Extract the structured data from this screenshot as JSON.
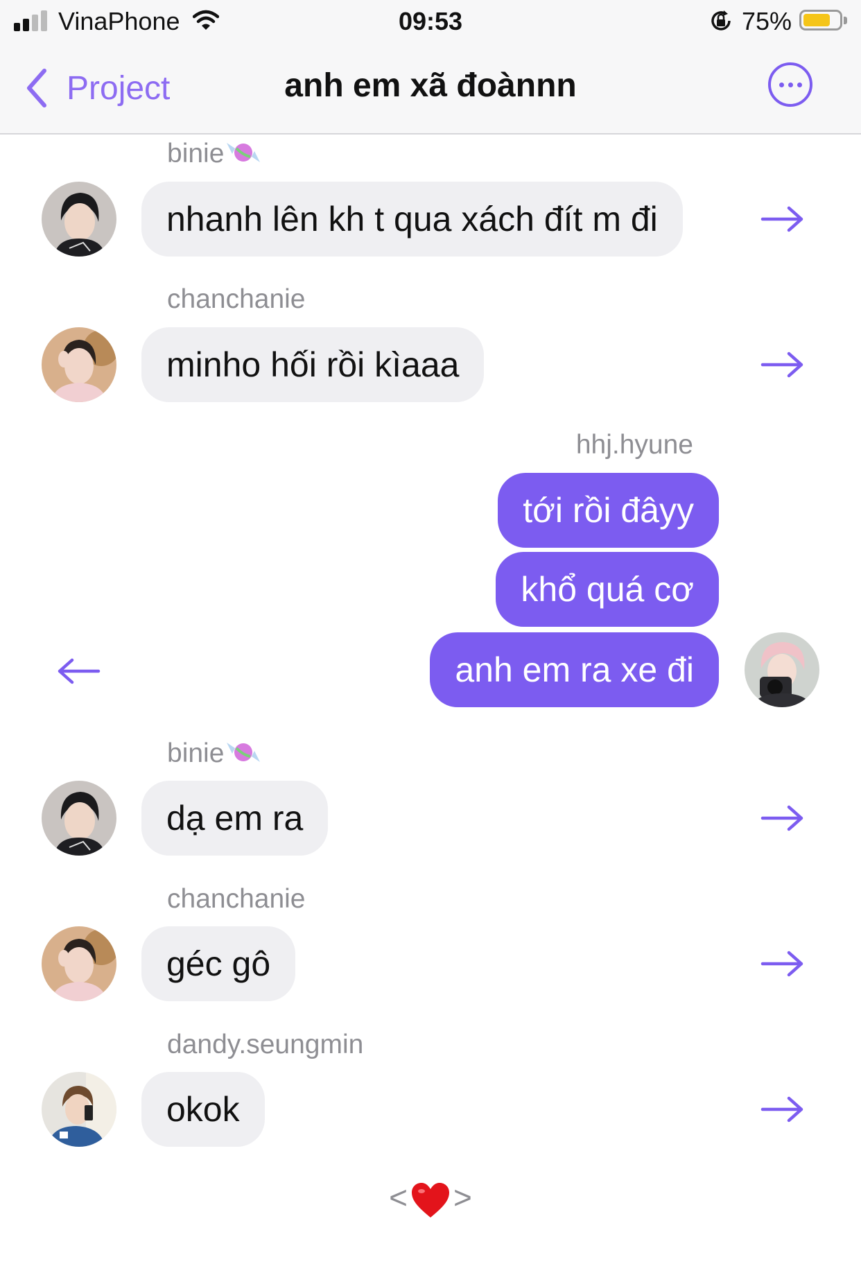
{
  "status_bar": {
    "carrier": "VinaPhone",
    "time": "09:53",
    "battery_percent": "75%",
    "battery_level": 0.75,
    "battery_color": "#f5c518",
    "icons": [
      "signal-icon",
      "wifi-icon",
      "orientation-lock-icon",
      "battery-icon"
    ]
  },
  "nav": {
    "back_label": "Project",
    "title": "anh em xã đoànnn",
    "more_icon": "ellipsis-circle-icon",
    "accent": "#7c5cf0"
  },
  "messages": [
    {
      "sender": "binie",
      "sender_emoji": "candy",
      "text": "nhanh lên kh t qua xách đít m đi",
      "direction": "incoming"
    },
    {
      "sender": "chanchanie",
      "text": "minho hối rồi kìaaa",
      "direction": "incoming"
    },
    {
      "sender": "hhj.hyune",
      "direction": "outgoing",
      "texts": [
        "tới rồi đâyy",
        "khổ quá cơ",
        "anh em ra xe đi"
      ]
    },
    {
      "sender": "binie",
      "sender_emoji": "candy",
      "text": "dạ em ra",
      "direction": "incoming"
    },
    {
      "sender": "chanchanie",
      "text": "géc gô",
      "direction": "incoming"
    },
    {
      "sender": "dandy.seungmin",
      "text": "okok",
      "direction": "incoming"
    }
  ],
  "footer": {
    "left": "<",
    "right": ">",
    "heart_icon": "heart-icon"
  },
  "colors": {
    "incoming_bubble": "#efeff2",
    "outgoing_bubble": "#7c5cf0",
    "sender_text": "#8e8e93"
  }
}
